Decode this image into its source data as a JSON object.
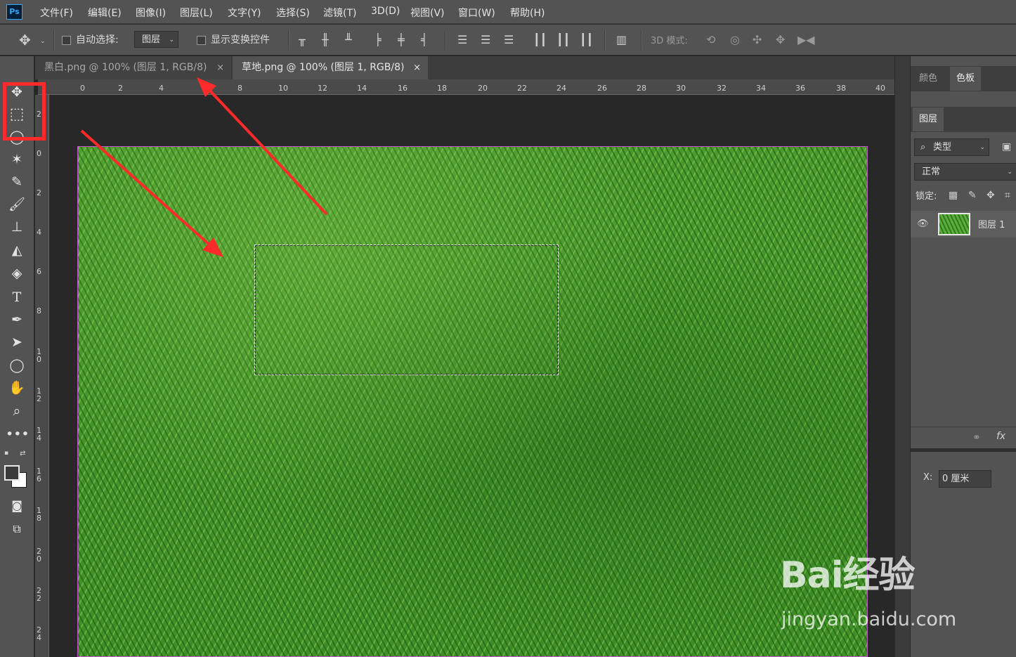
{
  "app": {
    "logo": "Ps"
  },
  "menu": [
    "文件(F)",
    "编辑(E)",
    "图像(I)",
    "图层(L)",
    "文字(Y)",
    "选择(S)",
    "滤镜(T)",
    "3D(D)",
    "视图(V)",
    "窗口(W)",
    "帮助(H)"
  ],
  "options": {
    "auto_select_label": "自动选择:",
    "auto_select_value": "图层",
    "show_transform_label": "显示变换控件",
    "mode_3d_label": "3D 模式:"
  },
  "tabs": [
    {
      "label": "黑白.png @ 100% (图层 1, RGB/8)",
      "close": "×",
      "active": false
    },
    {
      "label": "草地.png @ 100% (图层 1, RGB/8)",
      "close": "×",
      "active": true
    }
  ],
  "ruler": {
    "h_labels": [
      "0",
      "2",
      "4",
      "8",
      "10",
      "12",
      "14",
      "16",
      "18",
      "20",
      "22",
      "24",
      "26",
      "28",
      "30",
      "32",
      "34",
      "36",
      "38",
      "40"
    ],
    "v_labels": [
      "2",
      "0",
      "2",
      "4",
      "6",
      "8",
      "10",
      "12",
      "14",
      "16",
      "18",
      "20",
      "22",
      "24"
    ]
  },
  "panels": {
    "color_tab": "颜色",
    "swatches_tab": "色板",
    "layers_tab": "图层",
    "filter_kind": "类型",
    "blend_mode": "正常",
    "lock_label": "锁定:",
    "layer_name": "图层 1",
    "x_label": "X:",
    "x_value": "0 厘米"
  },
  "icons": {
    "move": "move-icon",
    "marquee": "rect-marquee-icon",
    "lasso": "lasso-icon",
    "magic": "quick-select-icon",
    "eyedropper": "eyedropper-icon",
    "brush": "brush-icon",
    "stamp": "clone-stamp-icon",
    "eraser": "eraser-icon",
    "bucket": "paint-bucket-icon",
    "type": "type-icon",
    "pen": "pen-icon",
    "path_select": "path-select-icon",
    "ellipse": "ellipse-icon",
    "hand": "hand-icon",
    "zoom": "zoom-icon",
    "more": "more-icon"
  },
  "colors": {
    "annotation": "#ff2a2a",
    "selection_border": "#c44fd1",
    "grass": "#4a9d2e"
  },
  "watermark": {
    "main": "Bai经验",
    "sub": "jingyan.baidu.com"
  }
}
